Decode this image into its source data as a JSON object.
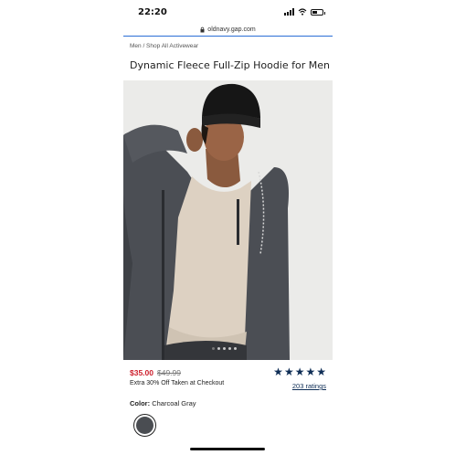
{
  "status_bar": {
    "time": "22:20"
  },
  "browser": {
    "url": "oldnavy.gap.com"
  },
  "breadcrumb": "Men / Shop All Activewear",
  "product": {
    "title": "Dynamic Fleece Full-Zip Hoodie for Men",
    "sale_price": "$35.00",
    "original_price": "$49.99",
    "promo": "Extra 30% Off Taken at Checkout",
    "rating": {
      "stars": 5,
      "count_label": "203 ratings"
    },
    "color_label": "Color:",
    "color_value": "Charcoal Gray",
    "image_count": 5,
    "active_image": 1
  },
  "colors": {
    "sale": "#cc1e2b",
    "star": "#0f2e56",
    "accent_line": "#2b6fd6",
    "swatch": "#4a4d52"
  }
}
